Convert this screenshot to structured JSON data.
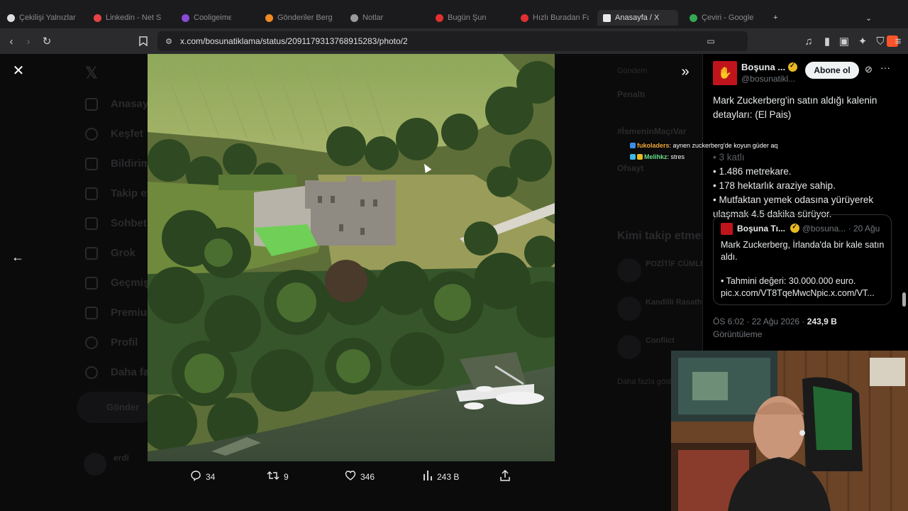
{
  "browser": {
    "tabs": [
      {
        "label": "Çekilişi Yalnızlar",
        "color": "#e0e0e0"
      },
      {
        "label": "Linkedin - Net Sa",
        "color": "#e64444"
      },
      {
        "label": "Cooligeimer",
        "color": "#8a4bd6"
      },
      {
        "label": "Gönderiler Berg",
        "color": "#f08a24"
      },
      {
        "label": "Notlar",
        "color": "#9a9a9a"
      },
      {
        "label": "Bugün Şun",
        "color": "#e23030"
      },
      {
        "label": "Hızlı Buradan Fark",
        "color": "#e23030"
      },
      {
        "label": "Anasayfa / X",
        "color": "#e7e9ea"
      },
      {
        "label": "Çeviri - Google",
        "color": "#34a853"
      }
    ],
    "url": "x.com/bosunatiklama/status/2091179313768915283/photo/2"
  },
  "sidebar_dim": {
    "items": [
      "Anasayfa",
      "Keşfet",
      "Bildirimler",
      "Takip et",
      "Sohbet",
      "Grok",
      "Geçmiş",
      "Premium",
      "Profil",
      "Daha fazla"
    ],
    "post_button": "Gönder",
    "user": "erdi"
  },
  "right_dim": {
    "lines": [
      "Gündem",
      "Penaltı",
      "#İsmeninMaçıVar",
      "Ofsayt",
      "Kimi takip etmeli",
      "POZİTİF CÜMLE",
      "Kandilli Rasathanesi",
      "Conflict",
      "Daha fazla göster"
    ]
  },
  "actions": {
    "replies": "34",
    "reposts": "9",
    "likes": "346",
    "views": "243 B"
  },
  "tweet": {
    "author_name": "Boşuna ...",
    "author_handle": "@bosunatikl...",
    "follow_label": "Abone ol",
    "text": "Mark Zuckerberg'in satın aldığı kalenin detayları: (El Pais)",
    "bullet_faded": "• 3 katlı",
    "bullet1": "• 1.486 metrekare.",
    "bullet2": "• 178 hektarlık araziye sahip.",
    "bullet3": "• Mutfaktan yemek odasına yürüyerek ulaşmak 4.5 dakika sürüyor.",
    "quote": {
      "author_name": "Boşuna Tı...",
      "author_handle": "@bosuna...",
      "date": "· 20 Ağu",
      "line1": "Mark Zuckerberg, İrlanda'da bir kale satın aldı.",
      "line2": "• Tahmini değeri: 30.000.000 euro.",
      "line3": "pic.x.com/VT8TqeMwcNpic.x.com/VT..."
    },
    "timestamp": "ÖS 6:02 · 22 Ağu 2026 ·",
    "views_count": "243,9 B",
    "views_label": "Görüntüleme"
  },
  "chat": [
    {
      "user": "fukoladers",
      "message": ": aynen zuckerberg'de koyun güder aq"
    },
    {
      "user": "Melihkz",
      "message": ": stres"
    }
  ]
}
